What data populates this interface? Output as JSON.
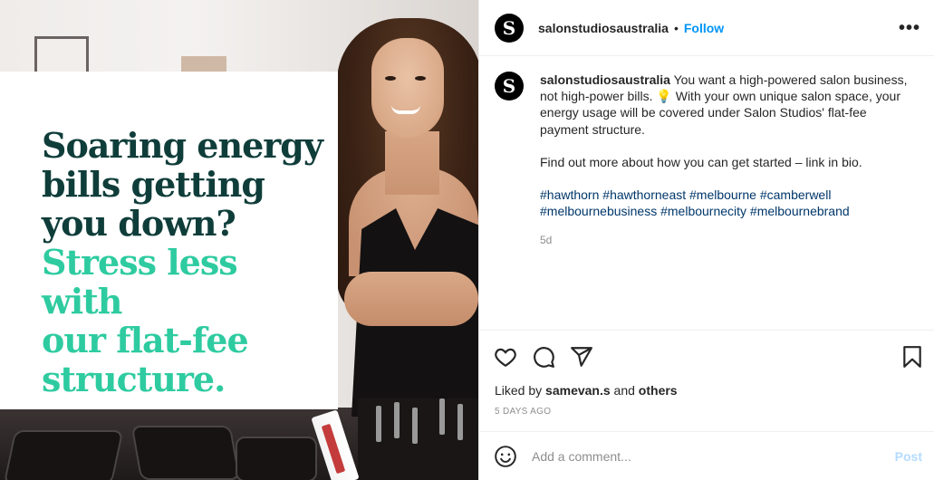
{
  "post_image": {
    "headline_lines": [
      "Soaring energy",
      "bills getting",
      "you down?"
    ],
    "highlight_lines": [
      "Stress less with",
      "our flat-fee",
      "structure."
    ],
    "headline_color": "#0f3d3a",
    "highlight_color": "#2ecba0"
  },
  "header": {
    "avatar_letter": "S",
    "username": "salonstudiosaustralia",
    "separator": "•",
    "follow_label": "Follow",
    "more_icon": "more-horizontal-icon"
  },
  "caption": {
    "username": "salonstudiosaustralia",
    "text_part1": "You want a high-powered salon business, not high-power bills. ",
    "emoji": "💡",
    "text_part2": " With your own unique salon space, your energy usage will be covered under Salon Studios' flat-fee payment structure.",
    "paragraph2": "Find out more about how you can get started – link in bio.",
    "hashtags": [
      "#hawthorn",
      "#hawthorneast",
      "#melbourne",
      "#camberwell",
      "#melbournebusiness",
      "#melbournecity",
      "#melbournebrand"
    ],
    "age": "5d"
  },
  "actions": {
    "icons": [
      "heart-icon",
      "comment-icon",
      "share-icon",
      "bookmark-icon"
    ],
    "liked_by_prefix": "Liked by",
    "liked_by_user": "samevan.s",
    "liked_by_and": "and",
    "liked_by_others": "others",
    "timestamp": "5 DAYS AGO"
  },
  "comment": {
    "placeholder": "Add a comment...",
    "post_label": "Post",
    "emoji_icon": "smiley-icon"
  },
  "colors": {
    "link_blue": "#0095f6",
    "hashtag_blue": "#00376b",
    "post_disabled": "#b3dbff"
  }
}
